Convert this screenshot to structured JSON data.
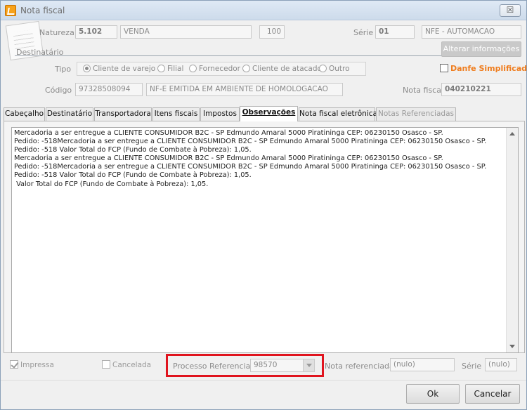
{
  "window": {
    "title": "Nota fiscal",
    "close_label": "☒"
  },
  "header": {
    "natureza_label": "Natureza",
    "natureza_code": "5.102",
    "natureza_desc": "VENDA",
    "natureza_num": "100",
    "serie_label": "Série",
    "serie_value": "01",
    "serie_desc": "NFE - AUTOMACAO",
    "destinatario_label": "Destinatário",
    "alterar_button": "Alterar informações",
    "tipo_label": "Tipo",
    "tipo_options": [
      "Cliente de varejo",
      "Filial",
      "Fornecedor",
      "Cliente de atacado",
      "Outro"
    ],
    "tipo_selected": "Cliente de varejo",
    "danfe_label": "Danfe Simplificado",
    "codigo_label": "Código",
    "codigo_value": "97328508094",
    "codigo_desc": "NF-E EMITIDA EM AMBIENTE DE HOMOLOGACAO",
    "nota_fiscal_label": "Nota fiscal",
    "nota_fiscal_value": "040210221"
  },
  "tabs": [
    {
      "label": "Cabeçalho"
    },
    {
      "label": "Destinatário"
    },
    {
      "label": "Transportadora"
    },
    {
      "label": "Itens fiscais"
    },
    {
      "label": "Impostos"
    },
    {
      "label": "Observações"
    },
    {
      "label": "Nota fiscal eletrônica"
    },
    {
      "label": "Notas Referenciadas"
    }
  ],
  "active_tab": "Observações",
  "observacoes": {
    "lines": [
      "Mercadoria a ser entregue a CLIENTE CONSUMIDOR B2C - SP Edmundo Amaral 5000 Piratininga CEP: 06230150 Osasco - SP.",
      "Pedido: -518Mercadoria a ser entregue a CLIENTE CONSUMIDOR B2C - SP Edmundo Amaral 5000 Piratininga CEP: 06230150 Osasco - SP.",
      "Pedido: -518 Valor Total do FCP (Fundo de Combate à Pobreza): 1,05.",
      "Mercadoria a ser entregue a CLIENTE CONSUMIDOR B2C - SP Edmundo Amaral 5000 Piratininga CEP: 06230150 Osasco - SP.",
      "Pedido: -518Mercadoria a ser entregue a CLIENTE CONSUMIDOR B2C - SP Edmundo Amaral 5000 Piratininga CEP: 06230150 Osasco - SP.",
      "Pedido: -518 Valor Total do FCP (Fundo de Combate à Pobreza): 1,05.",
      " Valor Total do FCP (Fundo de Combate à Pobreza): 1,05."
    ]
  },
  "footer": {
    "impressa_label": "Impressa",
    "cancelada_label": "Cancelada",
    "processo_label": "Processo Referenciado:",
    "processo_value": "98570",
    "nota_ref_label": "Nota referenciada",
    "nota_ref_value": "(nulo)",
    "serie_label": "Série",
    "serie_value": "(nulo)",
    "ok_label": "Ok",
    "cancel_label": "Cancelar"
  },
  "colors": {
    "danfe": "#ef7d1e",
    "highlight": "#e0141e"
  }
}
